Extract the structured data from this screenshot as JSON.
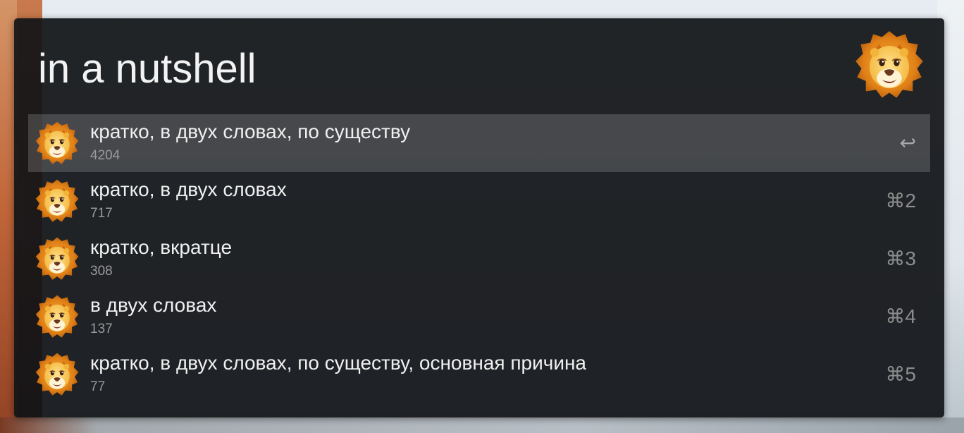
{
  "search": {
    "query": "in a nutshell"
  },
  "results": [
    {
      "title": "кратко, в двух словах, по существу",
      "subtitle": "4204",
      "shortcut": "↩",
      "selected": true,
      "icon": "lion-icon"
    },
    {
      "title": "кратко, в двух словах",
      "subtitle": "717",
      "shortcut": "⌘2",
      "selected": false,
      "icon": "lion-icon"
    },
    {
      "title": "кратко, вкратце",
      "subtitle": "308",
      "shortcut": "⌘3",
      "selected": false,
      "icon": "lion-icon"
    },
    {
      "title": "в двух словах",
      "subtitle": "137",
      "shortcut": "⌘4",
      "selected": false,
      "icon": "lion-icon"
    },
    {
      "title": "кратко, в двух словах, по существу, основная причина",
      "subtitle": "77",
      "shortcut": "⌘5",
      "selected": false,
      "icon": "lion-icon"
    }
  ],
  "colors": {
    "window_background": "#121418",
    "selected_row": "#3a3c40",
    "title_text": "#f0f0f0",
    "subtitle_text": "#9a9a9a",
    "lion_mane": "#e08a1c",
    "lion_face": "#f5c24a"
  }
}
